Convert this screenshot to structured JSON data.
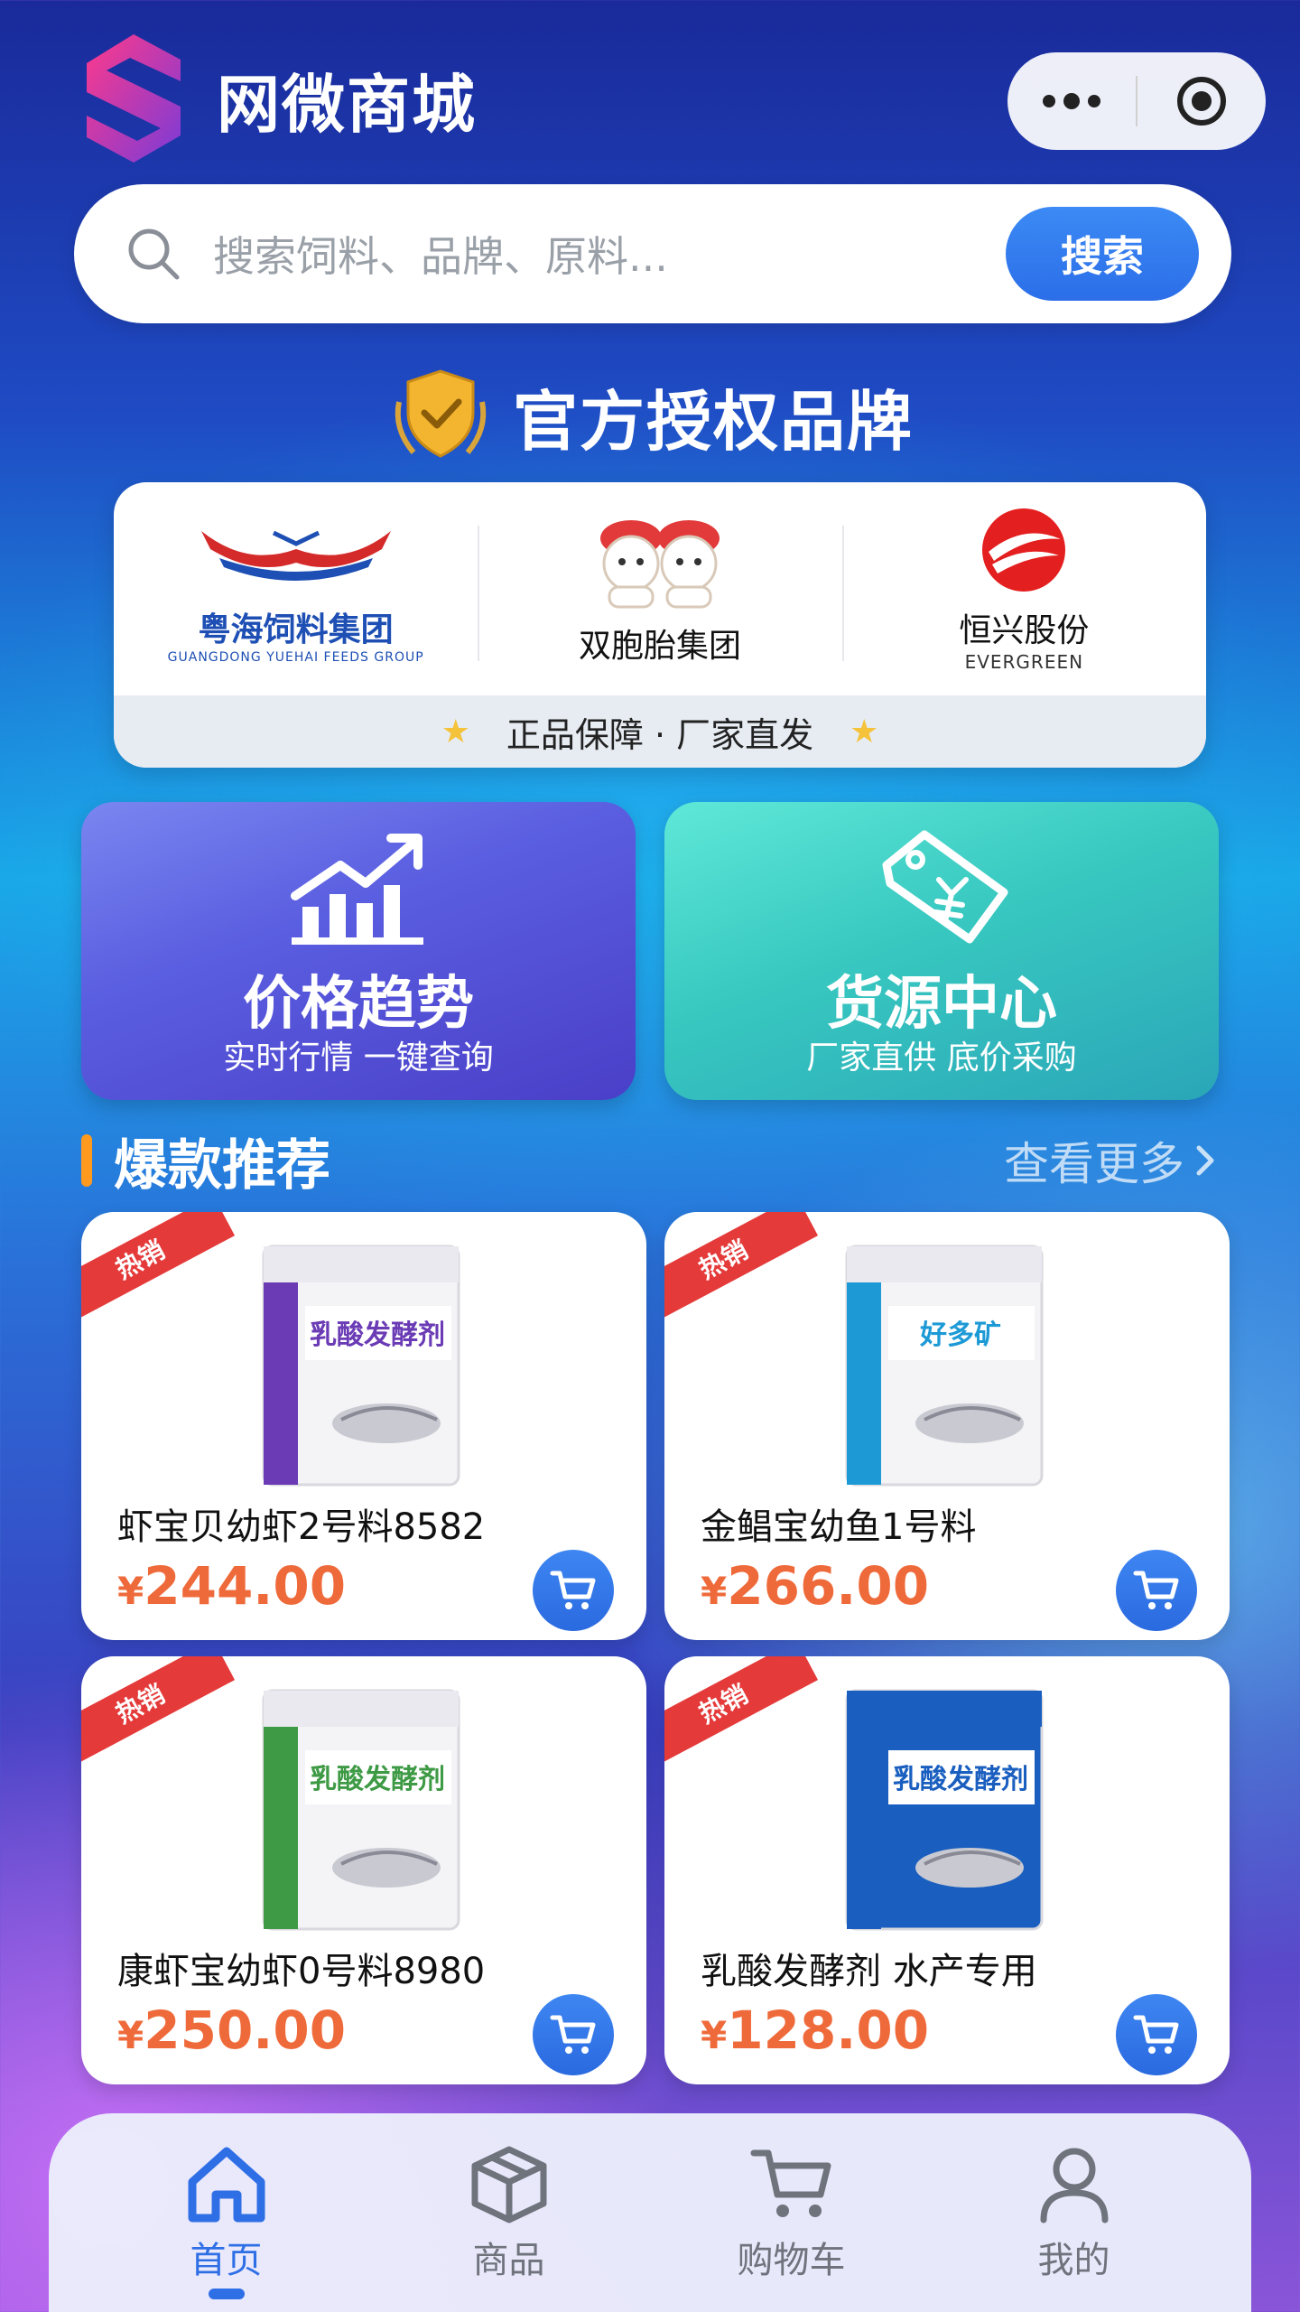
{
  "header": {
    "title": "网微商城"
  },
  "search": {
    "placeholder": "搜索饲料、品牌、原料...",
    "button": "搜索"
  },
  "brands": {
    "heading": "官方授权品牌",
    "items": [
      {
        "name": "粤海饲料集团",
        "en": "GUANGDONG YUEHAI FEEDS GROUP"
      },
      {
        "name": "双胞胎集团",
        "en": ""
      },
      {
        "name": "恒兴股份",
        "en": "EVERGREEN"
      }
    ],
    "footer": "正品保障 · 厂家直发"
  },
  "features": [
    {
      "title": "价格趋势",
      "subtitle": "实时行情 一键查询",
      "icon": "chart-trend-icon"
    },
    {
      "title": "货源中心",
      "subtitle": "厂家直供 底价采购",
      "icon": "price-tag-icon"
    }
  ],
  "section": {
    "title": "爆款推荐",
    "more": "查看更多"
  },
  "products": [
    {
      "badge": "热销",
      "name": "虾宝贝幼虾2号料8582",
      "currency": "¥",
      "price": "244.00",
      "pack_color": "#6a3bb5",
      "pack_text": "乳酸发酵剂"
    },
    {
      "badge": "热销",
      "name": "金鲳宝幼鱼1号料",
      "currency": "¥",
      "price": "266.00",
      "pack_color": "#1d9ad6",
      "pack_text": "好多矿"
    },
    {
      "badge": "热销",
      "name": "康虾宝幼虾0号料8980",
      "currency": "¥",
      "price": "250.00",
      "pack_color": "#3e9a45",
      "pack_text": "乳酸发酵剂"
    },
    {
      "badge": "热销",
      "name": "乳酸发酵剂 水产专用",
      "currency": "¥",
      "price": "128.00",
      "pack_color": "#1a5fbf",
      "pack_text": "乳酸发酵剂"
    }
  ],
  "tabbar": [
    {
      "label": "首页",
      "icon": "home-icon",
      "active": true
    },
    {
      "label": "商品",
      "icon": "box-icon",
      "active": false
    },
    {
      "label": "购物车",
      "icon": "cart-icon",
      "active": false
    },
    {
      "label": "我的",
      "icon": "user-icon",
      "active": false
    }
  ],
  "colors": {
    "accent": "#2f6fe6",
    "price": "#ef6a3a",
    "hot_badge": "#e53a3a",
    "section_bar": "#ff9a1f"
  }
}
